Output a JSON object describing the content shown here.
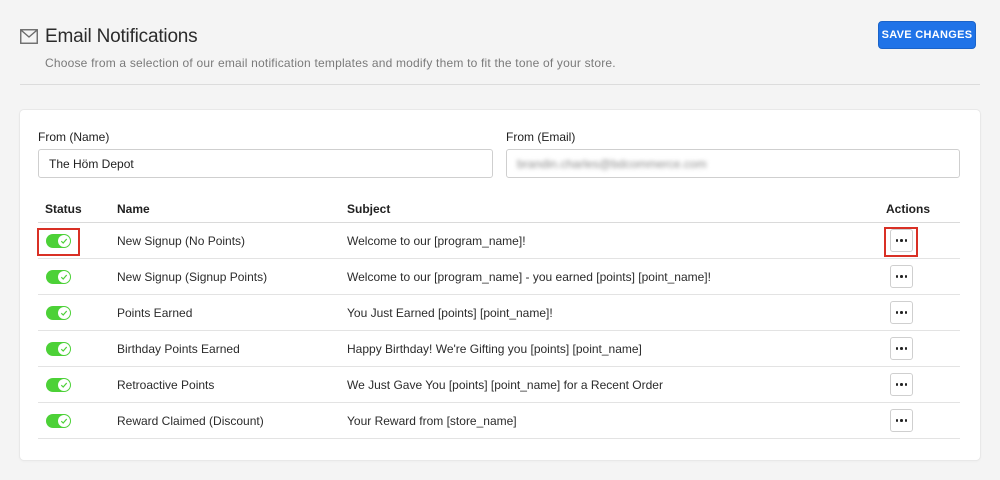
{
  "header": {
    "title": "Email Notifications",
    "subtitle": "Choose from a selection of our email notification templates and modify them to fit the tone of your store.",
    "save_label": "SAVE CHANGES",
    "icon": "mail-icon"
  },
  "form": {
    "from_name_label": "From (Name)",
    "from_name_value": "The Höm Depot",
    "from_email_label": "From (Email)",
    "from_email_value": "brandin.charles@bdcommerce.com"
  },
  "table": {
    "headers": {
      "status": "Status",
      "name": "Name",
      "subject": "Subject",
      "actions": "Actions"
    },
    "rows": [
      {
        "enabled": true,
        "name": "New Signup (No Points)",
        "subject": "Welcome to our [program_name]!"
      },
      {
        "enabled": true,
        "name": "New Signup (Signup Points)",
        "subject": "Welcome to our [program_name] - you earned [points] [point_name]!"
      },
      {
        "enabled": true,
        "name": "Points Earned",
        "subject": "You Just Earned [points] [point_name]!"
      },
      {
        "enabled": true,
        "name": "Birthday Points Earned",
        "subject": "Happy Birthday! We're Gifting you [points] [point_name]"
      },
      {
        "enabled": true,
        "name": "Retroactive Points",
        "subject": "We Just Gave You [points] [point_name] for a Recent Order"
      },
      {
        "enabled": true,
        "name": "Reward Claimed (Discount)",
        "subject": "Your Reward from [store_name]"
      }
    ]
  },
  "colors": {
    "accent": "#1f73e8",
    "toggle_on": "#4cd137",
    "highlight": "#d93025"
  }
}
